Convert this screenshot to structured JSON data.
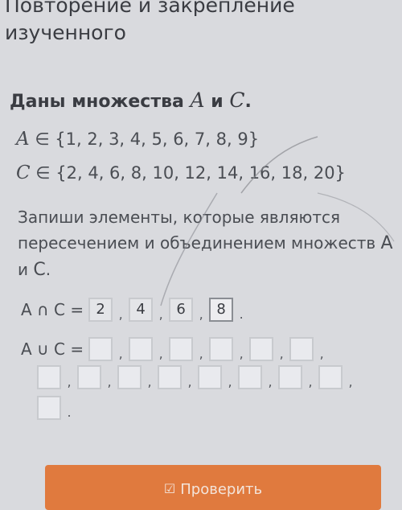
{
  "header": {
    "title": "Повторение и закрепление изученного"
  },
  "task": {
    "title_prefix": "Даны множества",
    "set_a_name": "A",
    "conjunction": "и",
    "set_c_name": "C",
    "title_suffix": ".",
    "set_a_definition": "∈ {1, 2, 3, 4, 5, 6, 7, 8, 9}",
    "set_c_definition": "∈ {2, 4, 6, 8, 10, 12, 14, 16, 18, 20}",
    "instruction": "Запиши элементы, которые являются пересечением и объединением множеств",
    "instruction_end": "."
  },
  "intersection": {
    "label": "A ∩ C =",
    "answers": [
      "2",
      "4",
      "6",
      "8"
    ],
    "end": "."
  },
  "union": {
    "label": "A ∪ C =",
    "row1_count": 6,
    "row2_count": 8,
    "row3_count": 1,
    "separator": ",",
    "end": "."
  },
  "actions": {
    "check_label": "Проверить",
    "check_icon": "checkbox-icon"
  },
  "colors": {
    "background": "#d9dade",
    "accent": "#e07a3e",
    "text": "#3e4046"
  }
}
